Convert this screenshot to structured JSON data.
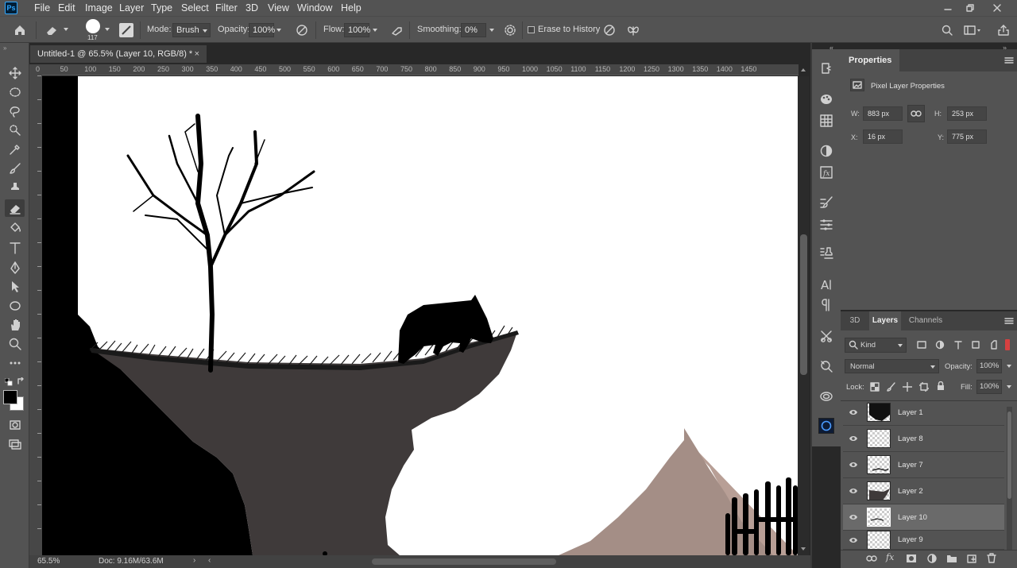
{
  "app": {
    "logo": "Ps"
  },
  "menu": [
    "File",
    "Edit",
    "Image",
    "Layer",
    "Type",
    "Select",
    "Filter",
    "3D",
    "View",
    "Window",
    "Help"
  ],
  "options": {
    "brush_size": "117",
    "mode_label": "Mode:",
    "mode_value": "Brush",
    "opacity_label": "Opacity:",
    "opacity_value": "100%",
    "flow_label": "Flow:",
    "flow_value": "100%",
    "smoothing_label": "Smoothing:",
    "smoothing_value": "0%",
    "erase_history_label": "Erase to History"
  },
  "document": {
    "tab_title": "Untitled-1 @ 65.5% (Layer 10, RGB/8) *",
    "zoom": "65.5%",
    "doc_info": "Doc: 9.16M/63.6M",
    "ruler_h": [
      "0",
      "50",
      "100",
      "150",
      "200",
      "250",
      "300",
      "350",
      "400",
      "450",
      "500",
      "550",
      "600",
      "650",
      "700",
      "750",
      "800",
      "850",
      "900",
      "950",
      "1000",
      "1050",
      "1100",
      "1150",
      "1200",
      "1250",
      "1300",
      "1350",
      "1400",
      "1450"
    ]
  },
  "properties": {
    "tab": "Properties",
    "title": "Pixel Layer Properties",
    "w_label": "W:",
    "w_value": "883 px",
    "h_label": "H:",
    "h_value": "253 px",
    "x_label": "X:",
    "x_value": "16 px",
    "y_label": "Y:",
    "y_value": "775 px"
  },
  "layers_panel": {
    "tabs": [
      "3D",
      "Layers",
      "Channels"
    ],
    "active_tab": "Layers",
    "kind_label": "Kind",
    "blend_mode": "Normal",
    "opacity_label": "Opacity:",
    "opacity_value": "100%",
    "lock_label": "Lock:",
    "fill_label": "Fill:",
    "fill_value": "100%",
    "layers": [
      {
        "name": "Layer 1",
        "selected": false
      },
      {
        "name": "Layer 8",
        "selected": false
      },
      {
        "name": "Layer 7",
        "selected": false
      },
      {
        "name": "Layer 2",
        "selected": false
      },
      {
        "name": "Layer 10",
        "selected": true
      },
      {
        "name": "Layer 9",
        "selected": false
      }
    ]
  },
  "colors": {
    "ui_bg": "#535353",
    "canvas": "#ffffff",
    "cliff": "#3f3a3a",
    "mountain": "#a48e86",
    "mountain_light": "#b89f96",
    "accent": "#31a8ff"
  }
}
